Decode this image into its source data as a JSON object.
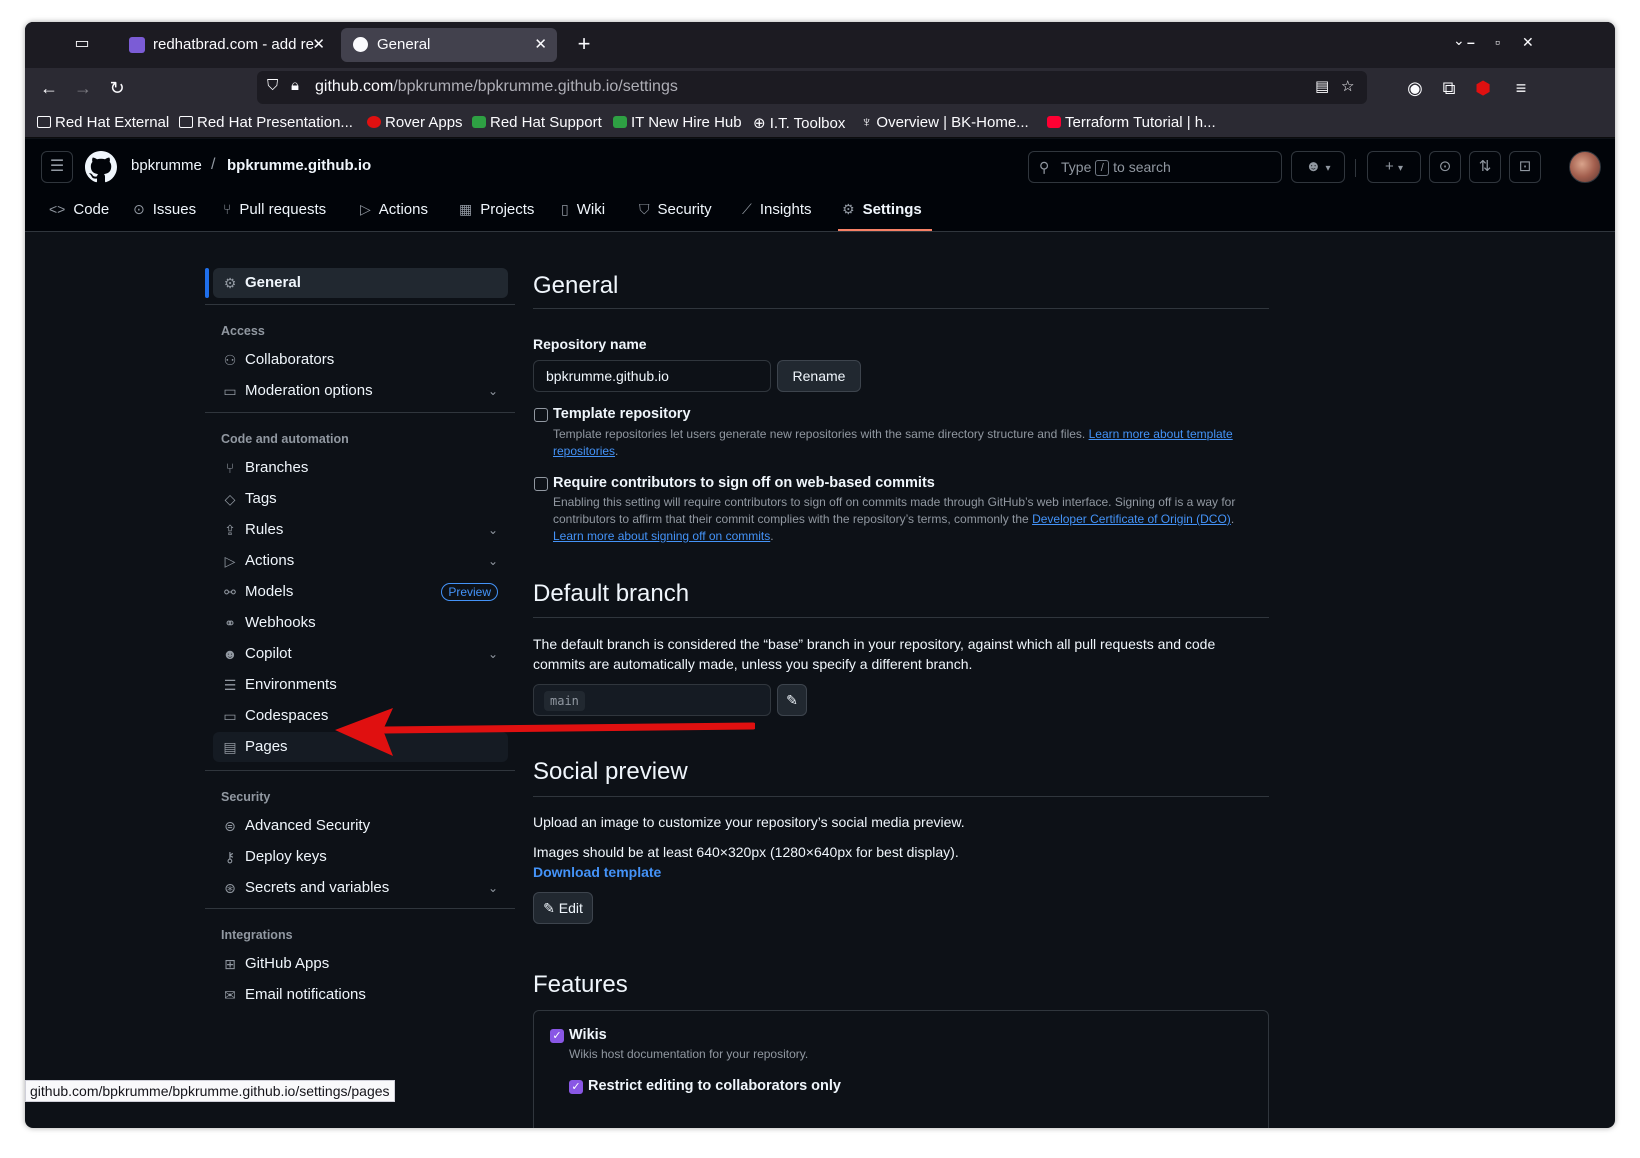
{
  "browser": {
    "tabs": [
      {
        "title": "redhatbrad.com - add re",
        "favicon_color": "#7b5cd6"
      },
      {
        "title": "General",
        "favicon_color": "#fbfbfe"
      }
    ],
    "url_host": "github.com",
    "url_path": "/bpkrumme/bpkrumme.github.io/settings",
    "bookmarks": [
      "Red Hat External",
      "Red Hat Presentation...",
      "Rover Apps",
      "Red Hat Support",
      "IT New Hire Hub",
      "I.T. Toolbox",
      "Overview | BK-Home...",
      "Terraform Tutorial | h..."
    ],
    "status_url": "github.com/bpkrumme/bpkrumme.github.io/settings/pages"
  },
  "header": {
    "owner": "bpkrumme",
    "repo": "bpkrumme.github.io",
    "search_prefix": "Type",
    "search_key": "/",
    "search_suffix": "to search"
  },
  "repo_nav": [
    "Code",
    "Issues",
    "Pull requests",
    "Actions",
    "Projects",
    "Wiki",
    "Security",
    "Insights",
    "Settings"
  ],
  "sidebar": {
    "general": "General",
    "groups": {
      "access": "Access",
      "code": "Code and automation",
      "security": "Security",
      "integrations": "Integrations"
    },
    "access_items": [
      "Collaborators",
      "Moderation options"
    ],
    "code_items": [
      "Branches",
      "Tags",
      "Rules",
      "Actions",
      "Models",
      "Webhooks",
      "Copilot",
      "Environments",
      "Codespaces",
      "Pages"
    ],
    "models_badge": "Preview",
    "security_items": [
      "Advanced Security",
      "Deploy keys",
      "Secrets and variables"
    ],
    "integration_items": [
      "GitHub Apps",
      "Email notifications"
    ]
  },
  "main": {
    "title": "General",
    "repo_name_label": "Repository name",
    "repo_name_value": "bpkrumme.github.io",
    "rename_label": "Rename",
    "template_title": "Template repository",
    "template_desc": "Template repositories let users generate new repositories with the same directory structure and files.",
    "template_link": "Learn more about template repositories",
    "signoff_title": "Require contributors to sign off on web-based commits",
    "signoff_desc": "Enabling this setting will require contributors to sign off on commits made through GitHub’s web interface. Signing off is a way for contributors to affirm that their commit complies with the repository’s terms, commonly the",
    "signoff_link1": "Developer Certificate of Origin (DCO)",
    "signoff_link2": "Learn more about signing off on commits",
    "default_branch_title": "Default branch",
    "default_branch_desc": "The default branch is considered the “base” branch in your repository, against which all pull requests and code commits are automatically made, unless you specify a different branch.",
    "default_branch_value": "main",
    "social_title": "Social preview",
    "social_desc1": "Upload an image to customize your repository’s social media preview.",
    "social_desc2": "Images should be at least 640×320px (1280×640px for best display).",
    "download_template": "Download template",
    "edit_label": "Edit",
    "features_title": "Features",
    "wikis_title": "Wikis",
    "wikis_desc": "Wikis host documentation for your repository.",
    "restrict_title": "Restrict editing to collaborators only"
  },
  "colors": {
    "accent_blue": "#1f6feb",
    "active_underline": "#f78166",
    "checkbox_purple": "#8957e5",
    "annotation_arrow": "#e01010"
  }
}
